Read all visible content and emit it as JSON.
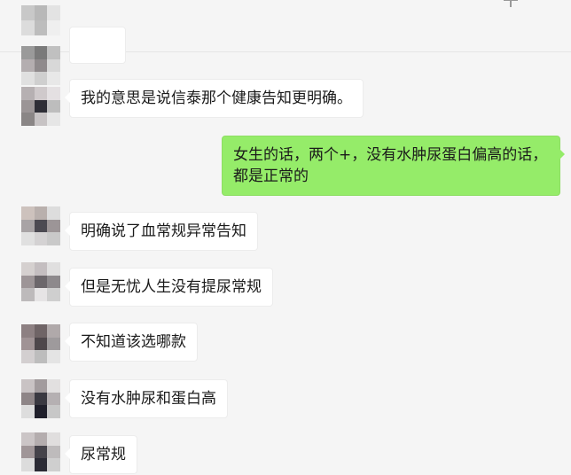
{
  "messages": [
    {
      "side": "left",
      "text": "我的意思是说信泰那个健康告知更明确。"
    },
    {
      "side": "right",
      "text": "女生的话，两个+，没有水肿尿蛋白偏高的话，都是正常的"
    },
    {
      "side": "left",
      "text": "明确说了血常规异常告知"
    },
    {
      "side": "left",
      "text": "但是无忧人生没有提尿常规"
    },
    {
      "side": "left",
      "text": "不知道该选哪款"
    },
    {
      "side": "left",
      "text": "没有水肿尿和蛋白高"
    },
    {
      "side": "left",
      "text": "尿常规"
    }
  ],
  "avatar_colors": {
    "a0": [
      "#c8c8c8",
      "#b8b8b8",
      "#e3e3e3",
      "#dcdcdc",
      "#bdbdbd",
      "#efefef"
    ],
    "a1": [
      "#9a9a9a",
      "#7a7a7a",
      "#c0c0c0",
      "#b4aeb0",
      "#8f8a8c",
      "#d8d8d8",
      "#e0e0e0",
      "#cfcfcf",
      "#e8e8e8"
    ],
    "a2": [
      "#b6b0b2",
      "#cfc9cb",
      "#e4e0e2",
      "#9b9596",
      "#2e2e36",
      "#bdbdbd",
      "#8a8686",
      "#c7c3c4",
      "#e6e6e6"
    ],
    "a3": [
      "#cdc2bd",
      "#b9b0ad",
      "#dddddd",
      "#a8a3a5",
      "#4c4a52",
      "#9c9597",
      "#e0e0e0",
      "#d4d2d3",
      "#c9c9c9"
    ],
    "a4": [
      "#d5d0cf",
      "#c4bec0",
      "#e0dfdf",
      "#9d9597",
      "#6c676b",
      "#8d898c",
      "#bdbabb",
      "#e6e4e5",
      "#cfcfcf"
    ],
    "a5": [
      "#8d8082",
      "#6f6466",
      "#b0a9aa",
      "#a09395",
      "#4e474b",
      "#9e9a9c",
      "#d3cfd0",
      "#bdbdbd",
      "#e4e4e4"
    ],
    "a6": [
      "#c9c3c4",
      "#a29b9d",
      "#e2e0e0",
      "#8e8587",
      "#3a3941",
      "#b5b0b2",
      "#ddd",
      "#1f1f2a",
      "#c7c7c7"
    ],
    "a7": [
      "#cbc5c6",
      "#b4adae",
      "#e0dede",
      "#a09698",
      "#45434a",
      "#bebbbc",
      "#dcdcdc",
      "#2a2a34",
      "#cfcfcf"
    ]
  }
}
